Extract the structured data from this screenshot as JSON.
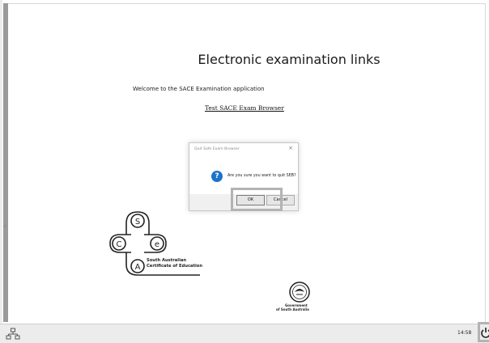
{
  "page": {
    "title": "Electronic examination links",
    "welcome": "Welcome to the SACE Examination application",
    "link": "Test SACE Exam Browser"
  },
  "dialog": {
    "title": "Quit Safe Exam Browser",
    "close_glyph": "×",
    "icon": "question-icon",
    "icon_glyph": "?",
    "message": "Are you sure you want to quit SEB?",
    "ok_label": "OK",
    "cancel_label": "Cancel"
  },
  "sace_logo": {
    "letters": [
      "S",
      "C",
      "e",
      "A"
    ],
    "line1": "South Australian",
    "line2": "Certificate of Education"
  },
  "gov_logo": {
    "line1": "Government",
    "line2": "of South Australia"
  },
  "taskbar": {
    "clock": "14:58",
    "network_icon": "network-icon",
    "power_icon": "power-icon"
  },
  "colors": {
    "dialog_icon": "#1e73c8",
    "highlight": "#b3b3b3",
    "taskbar": "#ececec"
  }
}
